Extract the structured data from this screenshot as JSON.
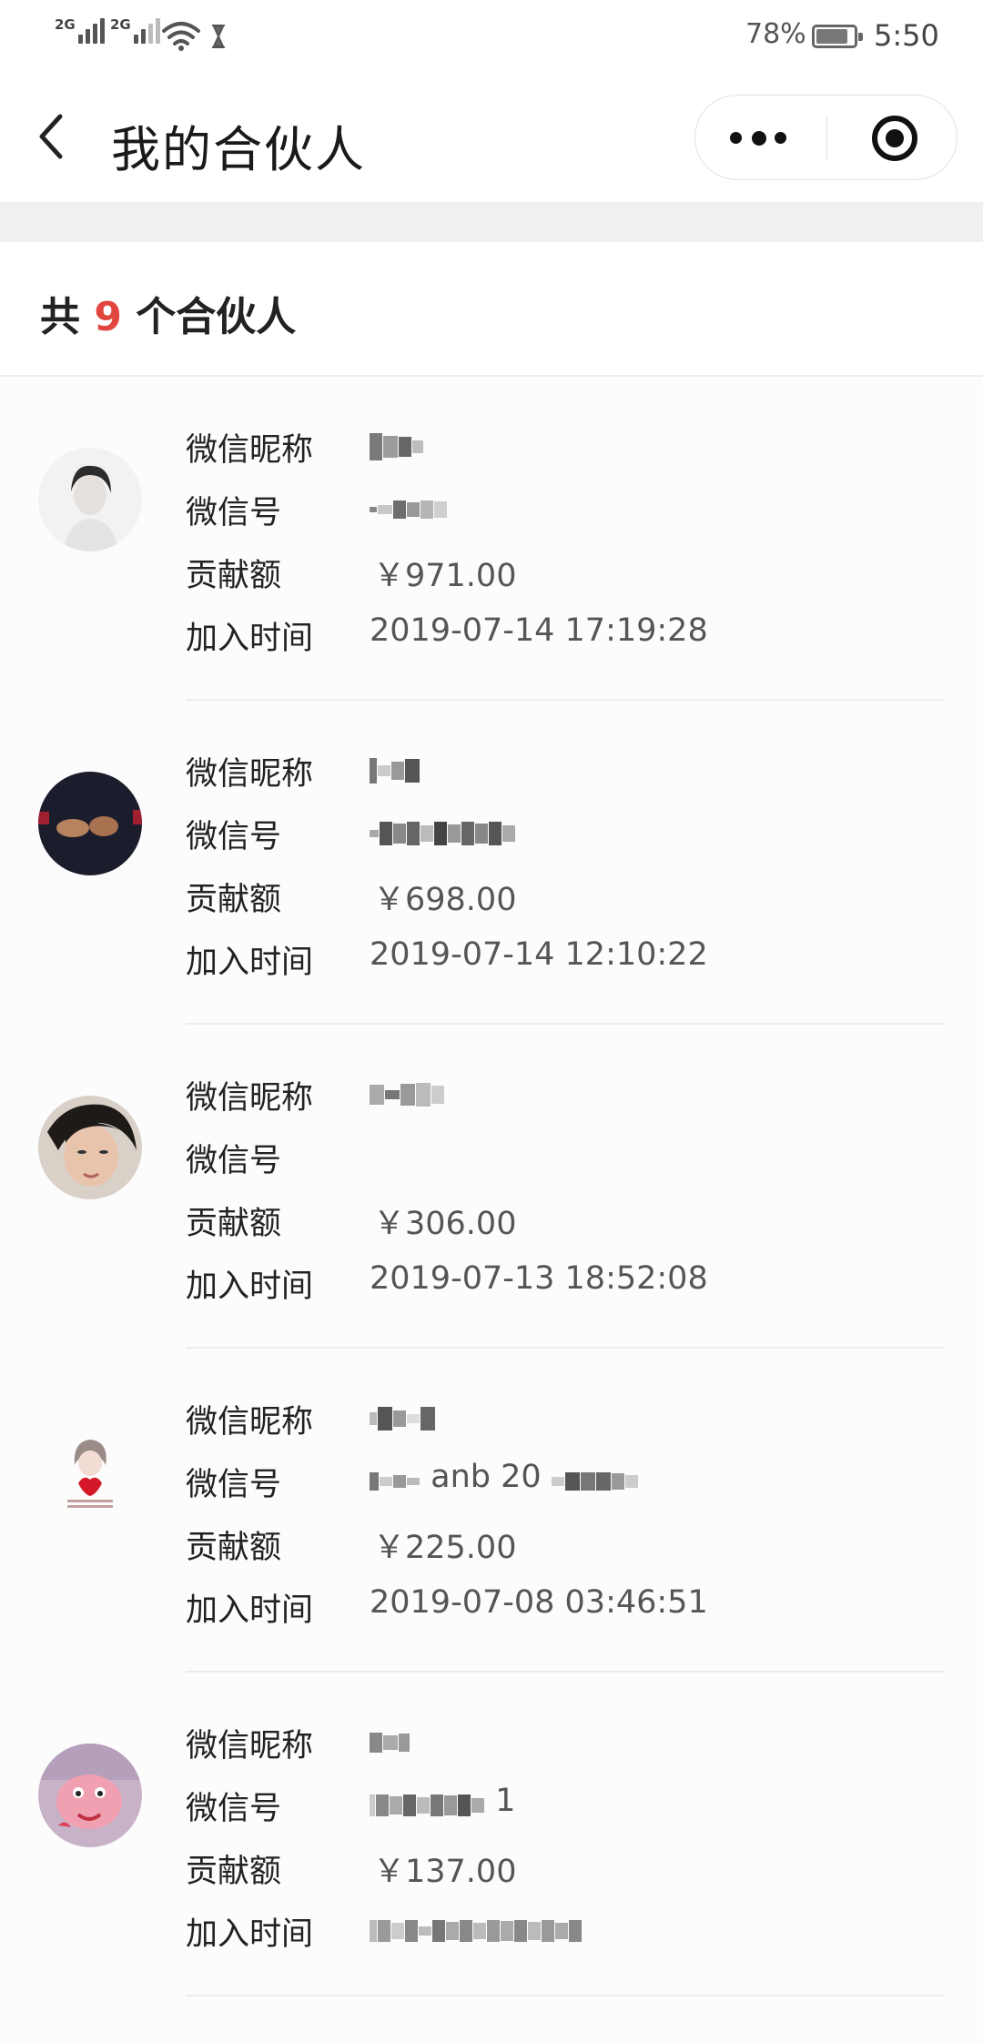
{
  "status_bar": {
    "signal1_label": "2G",
    "signal2_label": "2G",
    "battery_percent": "78%",
    "time": "5:50"
  },
  "nav": {
    "title": "我的合伙人"
  },
  "summary": {
    "prefix": "共",
    "count": "9",
    "suffix": "个合伙人"
  },
  "labels": {
    "nickname": "微信昵称",
    "wechat_id": "微信号",
    "contribution": "贡献额",
    "join_time": "加入时间"
  },
  "partners": [
    {
      "nickname": "",
      "wechat_id": "",
      "contribution": "￥971.00",
      "join_time": "2019-07-14 17:19:28"
    },
    {
      "nickname": "",
      "wechat_id": "",
      "contribution": "￥698.00",
      "join_time": "2019-07-14 12:10:22"
    },
    {
      "nickname": "",
      "wechat_id": "",
      "contribution": "￥306.00",
      "join_time": "2019-07-13 18:52:08"
    },
    {
      "nickname": "",
      "wechat_id": "anb 20",
      "contribution": "￥225.00",
      "join_time": "2019-07-08 03:46:51"
    },
    {
      "nickname": "",
      "wechat_id": "1",
      "contribution": "￥137.00",
      "join_time": ""
    }
  ],
  "colors": {
    "accent_count": "#e0463e",
    "background": "#fcfcfd",
    "separator": "#ececec"
  },
  "icons": {
    "back": "chevron-left-icon",
    "more": "more-dots-icon",
    "close": "target-circle-icon"
  }
}
